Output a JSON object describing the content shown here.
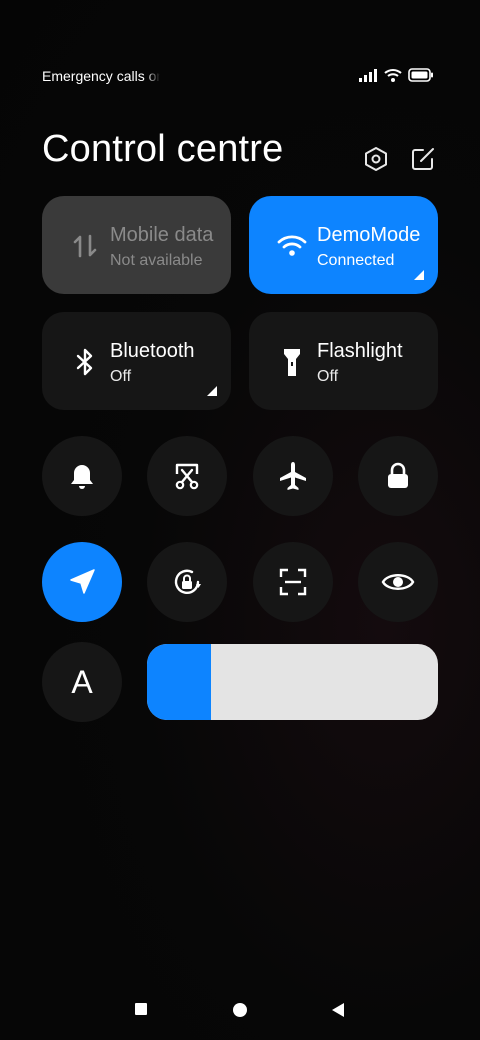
{
  "status_bar": {
    "carrier_text": "Emergency calls only",
    "icons": [
      "signal-icon",
      "wifi-icon",
      "battery-icon"
    ]
  },
  "header": {
    "title": "Control centre",
    "settings_icon": "settings-hexagon-icon",
    "edit_icon": "edit-icon"
  },
  "tiles": [
    {
      "name": "Mobile data",
      "status": "Not available",
      "icon": "mobile-data-icon",
      "state": "disabled"
    },
    {
      "name": "DemoMode",
      "status": "Connected",
      "icon": "wifi-icon",
      "state": "active"
    },
    {
      "name": "Bluetooth",
      "status": "Off",
      "icon": "bluetooth-icon",
      "state": "off"
    },
    {
      "name": "Flashlight",
      "status": "Off",
      "icon": "flashlight-icon",
      "state": "off"
    }
  ],
  "toggles": [
    {
      "icon": "bell-icon",
      "state": "off"
    },
    {
      "icon": "screenshot-icon",
      "state": "off"
    },
    {
      "icon": "airplane-icon",
      "state": "off"
    },
    {
      "icon": "lock-icon",
      "state": "off"
    },
    {
      "icon": "location-icon",
      "state": "on"
    },
    {
      "icon": "rotation-lock-icon",
      "state": "off"
    },
    {
      "icon": "scanner-icon",
      "state": "off"
    },
    {
      "icon": "eye-icon",
      "state": "off"
    },
    {
      "icon": "auto-brightness-icon",
      "label": "A",
      "state": "off"
    }
  ],
  "brightness": {
    "level": 0.22
  },
  "colors": {
    "accent": "#0d84ff",
    "tile": "#161616",
    "tile_disabled": "#3a3a3a",
    "slider_track": "#e4e4e4"
  },
  "nav": [
    "recents-square-icon",
    "home-circle-icon",
    "back-triangle-icon"
  ]
}
